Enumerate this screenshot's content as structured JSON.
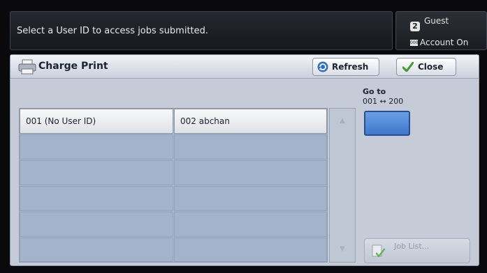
{
  "header": {
    "message": "Select a User ID to access jobs submitted."
  },
  "account": {
    "guest_icon_text": "2",
    "guest_label": "Guest",
    "account_icon_text": "000",
    "account_label": "Account On"
  },
  "panel": {
    "title": "Charge Print",
    "title_icon": "printer-icon",
    "refresh_label": "Refresh",
    "refresh_icon": "refresh-icon",
    "close_label": "Close",
    "close_icon": "checkmark-icon"
  },
  "users": [
    {
      "label": "001  (No User ID)"
    },
    {
      "label": "002  abchan"
    }
  ],
  "goto": {
    "label": "Go to",
    "range": "001 ↔ 200"
  },
  "scroll": {
    "up_glyph": "▲",
    "down_glyph": "▼"
  },
  "job_list": {
    "label": "Job List...",
    "icon": "job-list-icon"
  },
  "colors": {
    "panel_bg": "#c5cbd7",
    "list_bg": "#a9b7cd",
    "goto_button": "#4f86d6",
    "dark_bar": "#1b1d22"
  }
}
